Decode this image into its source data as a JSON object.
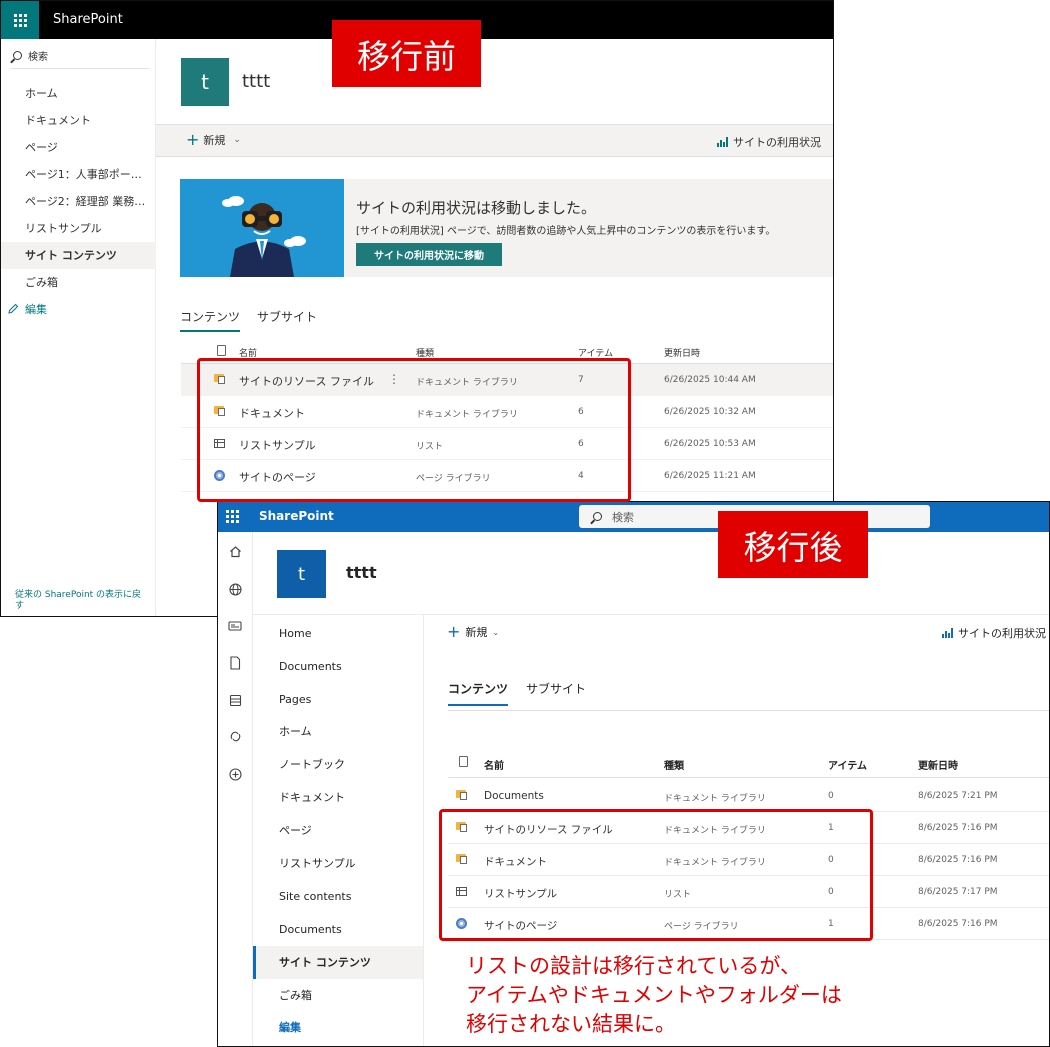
{
  "labels": {
    "before": "移行前",
    "after": "移行後"
  },
  "annotation": {
    "lines": [
      "リストの設計は移行されているが、",
      "アイテムやドキュメントやフォルダーは",
      "移行されない結果に。"
    ]
  },
  "colors": {
    "annotation_red": "#e00000",
    "classic_accent": "#03787c",
    "modern_accent": "#0f6cbd"
  },
  "before": {
    "brand": "SharePoint",
    "search_label": "検索",
    "nav_items": [
      "ホーム",
      "ドキュメント",
      "ページ",
      "ページ1：人事部ポー…",
      "ページ2：経理部 業務…",
      "リストサンプル",
      "サイト コンテンツ",
      "ごみ箱"
    ],
    "nav_selected_index": 6,
    "nav_edit": "編集",
    "nav_footer": "従来の SharePoint の表示に戻す",
    "site_logo_letter": "t",
    "site_title": "tttt",
    "cmd_new": "新規",
    "cmd_usage": "サイトの利用状況",
    "banner": {
      "title": "サイトの利用状況は移動しました。",
      "desc": "[サイトの利用状況] ページで、訪問者数の追跡や人気上昇中のコンテンツの表示を行います。",
      "button": "サイトの利用状況に移動"
    },
    "tabs": [
      "コンテンツ",
      "サブサイト"
    ],
    "columns": {
      "name": "名前",
      "type": "種類",
      "items": "アイテム",
      "modified": "更新日時"
    },
    "rows": [
      {
        "icon": "document-library-icon",
        "name": "サイトのリソース ファイル",
        "type": "ドキュメント ライブラリ",
        "items": "7",
        "modified": "6/26/2025 10:44 AM",
        "more": "⋮"
      },
      {
        "icon": "document-library-icon",
        "name": "ドキュメント",
        "type": "ドキュメント ライブラリ",
        "items": "6",
        "modified": "6/26/2025 10:32 AM"
      },
      {
        "icon": "list-icon",
        "name": "リストサンプル",
        "type": "リスト",
        "items": "6",
        "modified": "6/26/2025 10:53 AM"
      },
      {
        "icon": "pages-library-icon",
        "name": "サイトのページ",
        "type": "ページ ライブラリ",
        "items": "4",
        "modified": "6/26/2025 11:21 AM"
      }
    ]
  },
  "after": {
    "brand": "SharePoint",
    "search_placeholder": "検索",
    "site_logo_letter": "t",
    "site_title": "tttt",
    "rail_icons": [
      "home-icon",
      "globe-icon",
      "news-icon",
      "file-icon",
      "lists-icon",
      "loop-icon",
      "add-icon"
    ],
    "nav_items": [
      "Home",
      "Documents",
      "Pages",
      "ホーム",
      "ノートブック",
      "ドキュメント",
      "ページ",
      "リストサンプル",
      "Site contents",
      "Documents",
      "サイト コンテンツ",
      "ごみ箱",
      "編集"
    ],
    "nav_selected_index": 10,
    "cmd_new": "新規",
    "cmd_usage": "サイトの利用状況",
    "tabs": [
      "コンテンツ",
      "サブサイト"
    ],
    "columns": {
      "name": "名前",
      "type": "種類",
      "items": "アイテム",
      "modified": "更新日時"
    },
    "rows": [
      {
        "icon": "document-library-icon",
        "name": "Documents",
        "type": "ドキュメント ライブラリ",
        "items": "0",
        "modified": "8/6/2025 7:21 PM"
      },
      {
        "icon": "document-library-icon",
        "name": "サイトのリソース ファイル",
        "type": "ドキュメント ライブラリ",
        "items": "1",
        "modified": "8/6/2025 7:16 PM"
      },
      {
        "icon": "document-library-icon",
        "name": "ドキュメント",
        "type": "ドキュメント ライブラリ",
        "items": "0",
        "modified": "8/6/2025 7:16 PM"
      },
      {
        "icon": "list-icon",
        "name": "リストサンプル",
        "type": "リスト",
        "items": "0",
        "modified": "8/6/2025 7:17 PM"
      },
      {
        "icon": "pages-library-icon",
        "name": "サイトのページ",
        "type": "ページ ライブラリ",
        "items": "1",
        "modified": "8/6/2025 7:16 PM"
      }
    ]
  }
}
